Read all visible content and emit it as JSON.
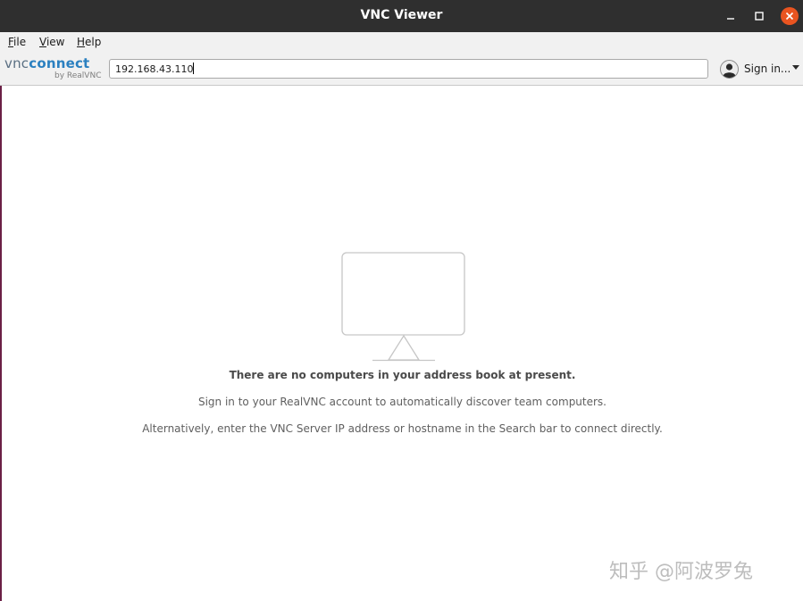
{
  "window": {
    "title": "VNC Viewer",
    "controls": {
      "minimize_icon": "minimize-icon",
      "maximize_icon": "maximize-icon",
      "close_icon": "close-icon",
      "close_color": "#e95420"
    }
  },
  "menu": {
    "items": [
      {
        "label": "File",
        "mnemonic": "F",
        "rest": "ile"
      },
      {
        "label": "View",
        "mnemonic": "V",
        "rest": "iew"
      },
      {
        "label": "Help",
        "mnemonic": "H",
        "rest": "elp"
      }
    ]
  },
  "toolbar": {
    "logo": {
      "vnc": "vnc",
      "connect": "connect",
      "byline": "by RealVNC"
    },
    "search": {
      "value": "192.168.43.110"
    },
    "signin": {
      "label": "Sign in...",
      "icon": "user-avatar-icon"
    }
  },
  "empty_state": {
    "icon": "monitor-icon",
    "title": "There are no computers in your address book at present.",
    "signin_hint": "Sign in to your RealVNC account to automatically discover team computers.",
    "alt_hint": "Alternatively, enter the VNC Server IP address or hostname in the Search bar to connect directly."
  },
  "watermark": {
    "text": "知乎 @阿波罗兔"
  },
  "colors": {
    "titlebar": "#2f2f2f",
    "accent": "#e95420",
    "brand_blue": "#2b80c0"
  }
}
